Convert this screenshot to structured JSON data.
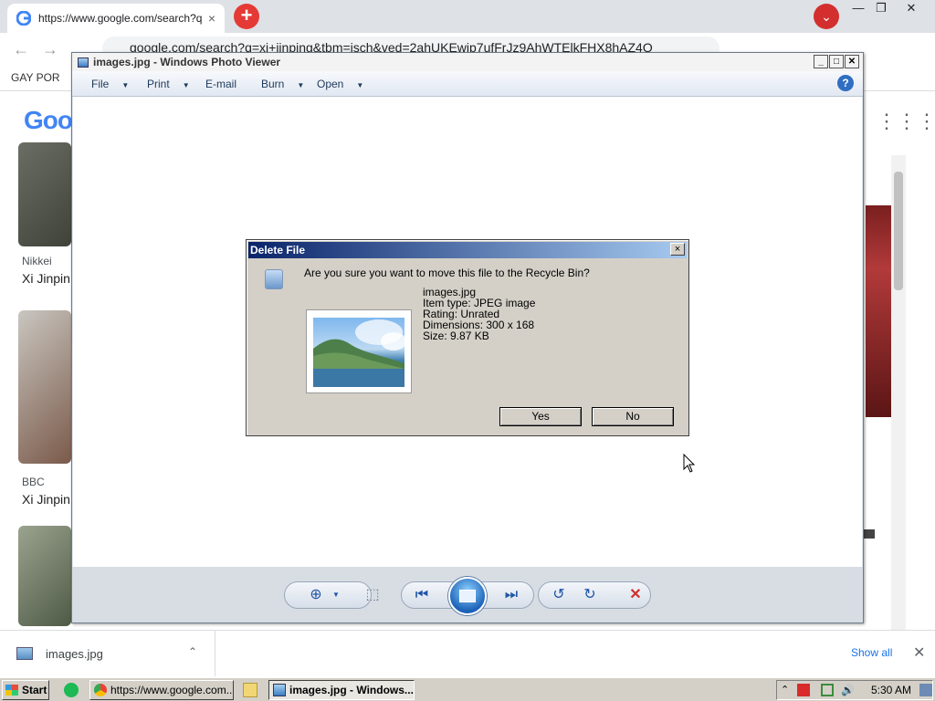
{
  "browser": {
    "tab_title": "https://www.google.com/search?q=",
    "tab_close": "×",
    "new_tab": "+",
    "tab_search": "⌄",
    "omnibox_url": "google.com/search?q=xi+jinping&tbm=isch&ved=2ahUKEwjp7ufFrJz9AhWTElkFHX8hAZ4Q",
    "bookmark_label": "GAY POR",
    "window_min": "—",
    "window_max": "❐",
    "window_close": "✕"
  },
  "google": {
    "logo": "Goo",
    "results": [
      {
        "source": "Nikkei",
        "title": "Xi Jinpin"
      },
      {
        "source": "BBC",
        "title": "Xi Jinpin"
      }
    ]
  },
  "downloads": {
    "file_name": "images.jpg",
    "show_all": "Show all",
    "close": "✕"
  },
  "photo_viewer": {
    "title": "images.jpg - Windows Photo Viewer",
    "menu": {
      "file": "File",
      "print": "Print",
      "email": "E-mail",
      "burn": "Burn",
      "open": "Open"
    },
    "help": "?",
    "controls": {
      "zoom": "⊕",
      "fit": "⬚",
      "prev": "⏮",
      "next": "⏭",
      "rotate_ccw": "↺",
      "rotate_cw": "↻",
      "delete": "✕"
    }
  },
  "dialog": {
    "title": "Delete File",
    "close": "×",
    "question": "Are you sure you want to move this file to the Recycle Bin?",
    "file_name": "images.jpg",
    "item_type": "Item type: JPEG image",
    "rating": "Rating: Unrated",
    "dimensions": "Dimensions: 300 x 168",
    "size": "Size: 9.87 KB",
    "yes": "Yes",
    "no": "No"
  },
  "taskbar": {
    "start": "Start",
    "chrome_task": "https://www.google.com...",
    "viewer_task": "images.jpg - Windows...",
    "clock": "5:30 AM"
  },
  "colors": {
    "dialog_title_start": "#0a246a",
    "dialog_title_end": "#a6caf0",
    "chrome_new_tab": "#e53935",
    "link_blue": "#1a73e8"
  }
}
